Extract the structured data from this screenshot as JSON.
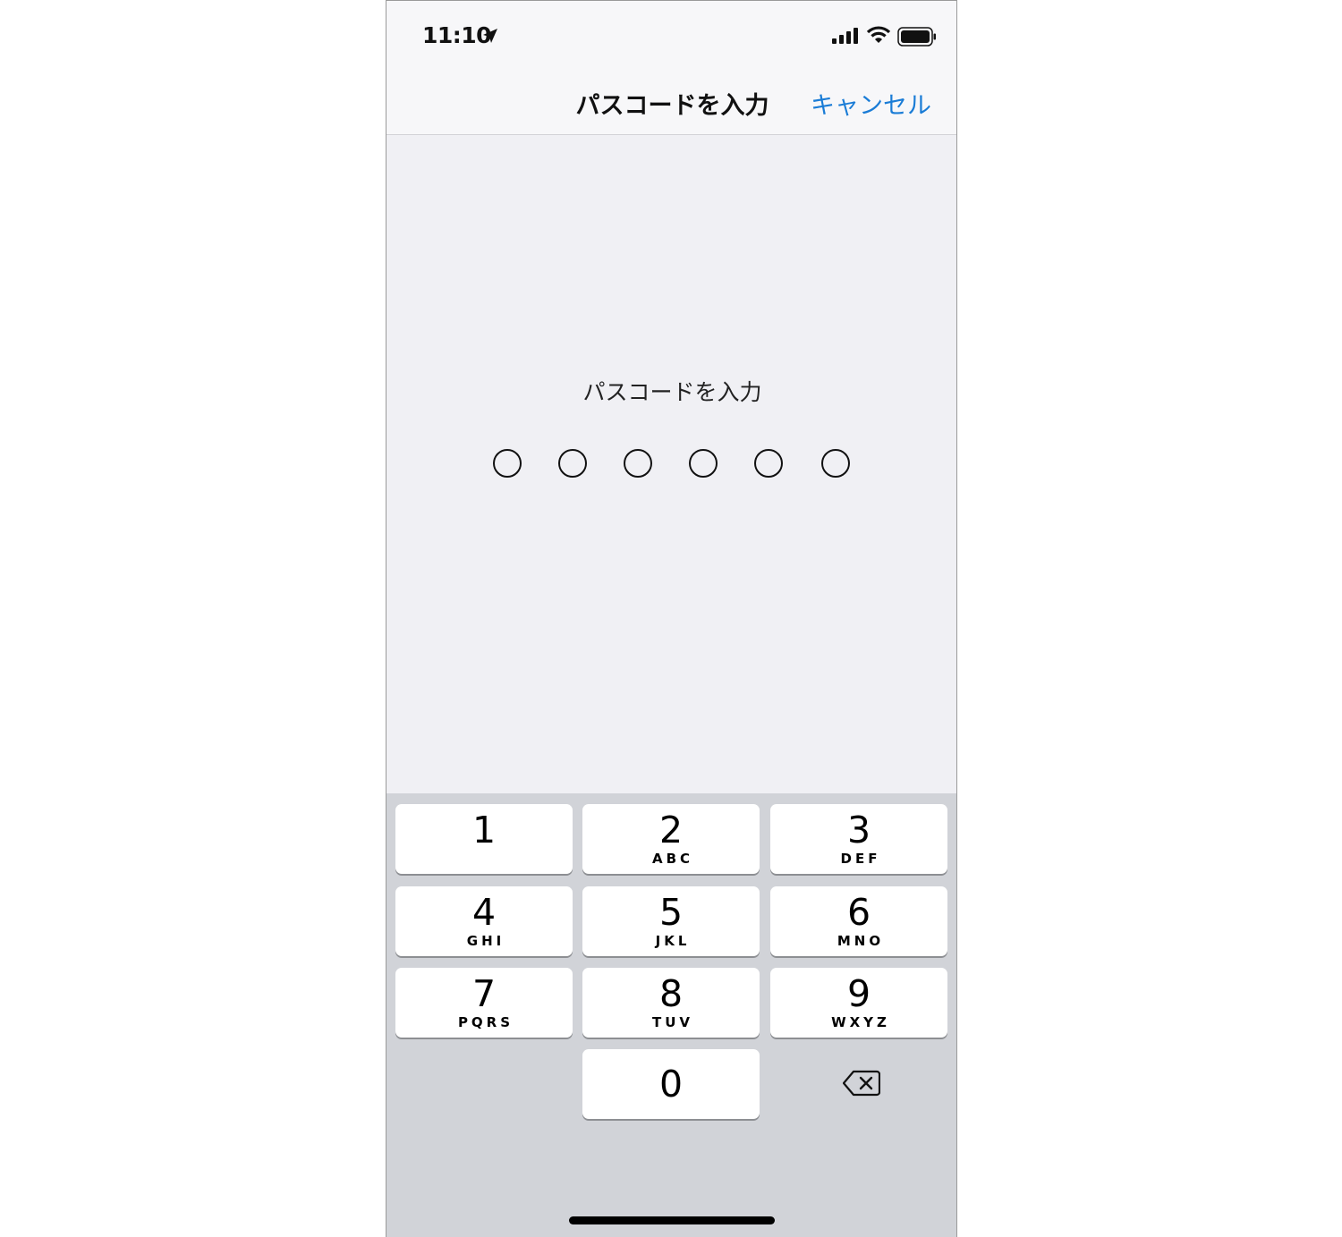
{
  "status_bar": {
    "time": "11:10",
    "icons": [
      "location-arrow-icon",
      "signal-icon",
      "wifi-icon",
      "battery-icon"
    ]
  },
  "nav": {
    "title": "パスコードを入力",
    "cancel_label": "キャンセル",
    "cancel_color": "#1a7cd6"
  },
  "prompt": "パスコードを入力",
  "passcode": {
    "length": 6,
    "filled": 0
  },
  "keypad": {
    "keys": [
      {
        "digit": "1",
        "letters": ""
      },
      {
        "digit": "2",
        "letters": "ABC"
      },
      {
        "digit": "3",
        "letters": "DEF"
      },
      {
        "digit": "4",
        "letters": "GHI"
      },
      {
        "digit": "5",
        "letters": "JKL"
      },
      {
        "digit": "6",
        "letters": "MNO"
      },
      {
        "digit": "7",
        "letters": "PQRS"
      },
      {
        "digit": "8",
        "letters": "TUV"
      },
      {
        "digit": "9",
        "letters": "WXYZ"
      },
      {
        "digit": "0",
        "letters": ""
      }
    ],
    "delete_icon": "backspace-icon"
  }
}
